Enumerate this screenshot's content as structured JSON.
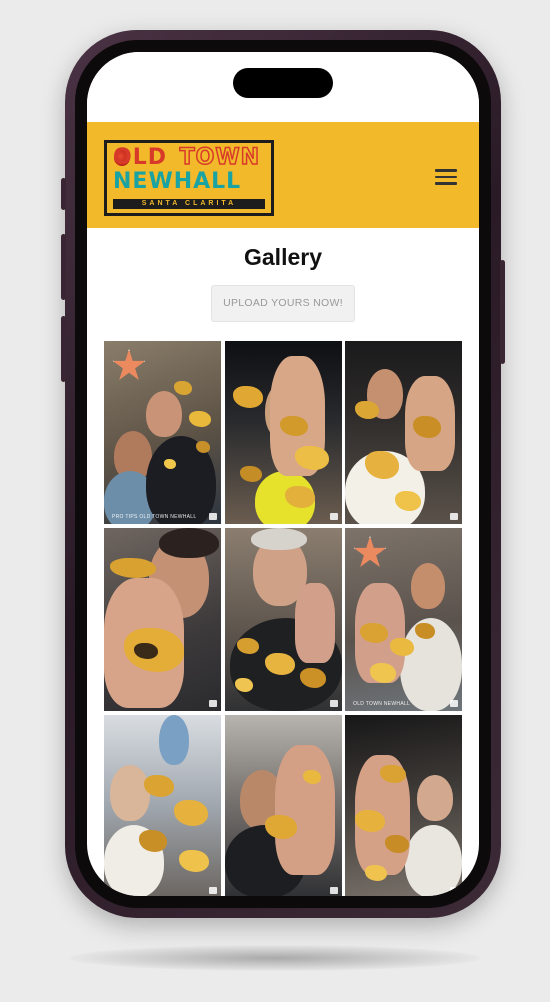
{
  "header": {
    "logo": {
      "line1_left": "OLD",
      "line1_right": "TOWN",
      "line2": "NEWHALL",
      "line3": "SANTA CLARITA"
    },
    "menu_icon": "hamburger-icon"
  },
  "main": {
    "title": "Gallery",
    "upload_label": "UPLOAD YOURS NOW!"
  },
  "gallery": {
    "tiles": [
      {
        "caption": "PRO TIPS OLD TOWN NEWHALL"
      },
      {
        "caption": ""
      },
      {
        "caption": ""
      },
      {
        "caption": ""
      },
      {
        "caption": ""
      },
      {
        "caption": "OLD TOWN NEWHALL"
      },
      {
        "caption": ""
      },
      {
        "caption": ""
      },
      {
        "caption": ""
      }
    ]
  },
  "colors": {
    "header_bg": "#f2b92a",
    "logo_red": "#d83a2a",
    "logo_teal": "#1aa3a3",
    "phone_frame": "#3a2632"
  }
}
